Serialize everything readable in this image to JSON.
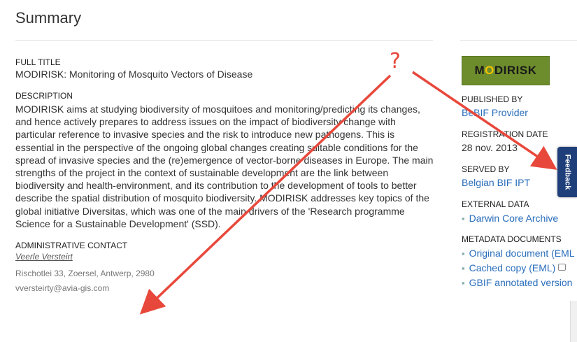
{
  "page": {
    "title": "Summary"
  },
  "main": {
    "full_title_label": "FULL TITLE",
    "full_title": "MODIRISK: Monitoring of Mosquito Vectors of Disease",
    "description_label": "DESCRIPTION",
    "description": "MODIRISK aims at studying biodiversity of mosquitoes and monitoring/predicting its changes, and hence actively prepares to address issues on the impact of biodiversity change with particular reference to invasive species and the risk to introduce new pathogens. This is essential in the perspective of the ongoing global changes creating suitable conditions for the spread of invasive species and the (re)emergence of vector-borne diseases in Europe. The main strengths of the project in the context of sustainable development are the link between biodiversity and health-environment, and its contribution to the development of tools to better describe the spatial distribution of mosquito biodiversity. MODIRISK addresses key topics of the global initiative Diversitas, which was one of the main drivers of the 'Research programme Science for a Sustainable Development' (SSD).",
    "admin_contact_label": "ADMINISTRATIVE CONTACT",
    "contact_name": "Veerle Versteirt",
    "contact_address": "Rischotlei 33, Zoersel, Antwerp, 2980",
    "contact_email": "vversteirty@avia-gis.com"
  },
  "sidebar": {
    "logo_text_pre": "M",
    "logo_mark": "O",
    "logo_text_post": "DIRISK",
    "published_by_label": "PUBLISHED BY",
    "published_by": "BeBIF Provider",
    "registration_date_label": "REGISTRATION DATE",
    "registration_date": "28 nov. 2013",
    "served_by_label": "SERVED BY",
    "served_by": "Belgian BIF IPT",
    "external_data_label": "EXTERNAL DATA",
    "external_data": [
      "Darwin Core Archive"
    ],
    "metadata_documents_label": "METADATA DOCUMENTS",
    "metadata_documents": [
      "Original document (EML",
      "Cached copy (EML)",
      "GBIF annotated version"
    ]
  },
  "feedback": {
    "label": "Feedback"
  },
  "annotation": {
    "question_mark": "?",
    "arrow_color": "#e8483b"
  }
}
